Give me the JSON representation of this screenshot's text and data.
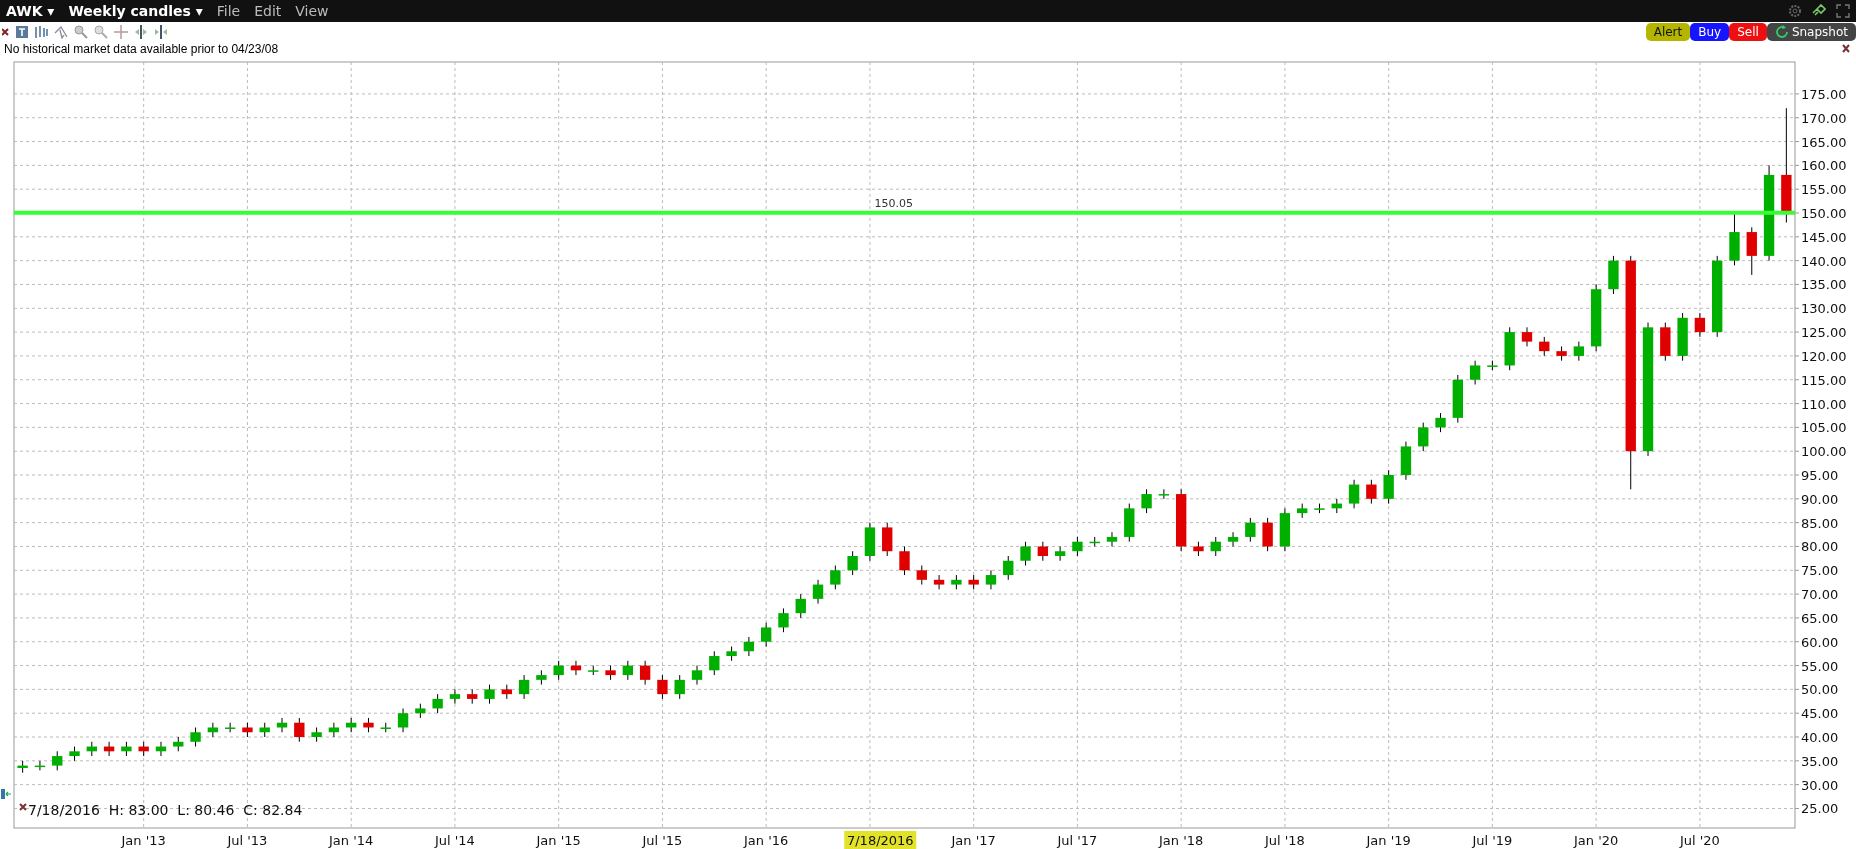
{
  "menubar": {
    "dropdowns": [
      {
        "label": "AWK",
        "caret": "▾"
      },
      {
        "label": "Weekly candles",
        "caret": "▾"
      }
    ],
    "menus": [
      "File",
      "Edit",
      "View"
    ]
  },
  "toolbar": {
    "buttons": [
      {
        "label": "Alert",
        "kind": "alert"
      },
      {
        "label": "Buy",
        "kind": "buy"
      },
      {
        "label": "Sell",
        "kind": "sell"
      },
      {
        "label": "Snapshot",
        "kind": "snapshot"
      }
    ]
  },
  "notice": "No historical market data available prior to 04/23/08",
  "crosshair": {
    "date": "7/18/2016",
    "readout": "H: 83.00  L: 80.46  C: 82.84",
    "axis_label": "7/18/2016"
  },
  "chart_data": {
    "type": "candlestick",
    "grid": true,
    "categories": [
      null,
      null,
      null,
      null,
      null,
      null,
      null,
      "Jan '13",
      null,
      null,
      null,
      null,
      null,
      "Jul '13",
      null,
      null,
      null,
      null,
      null,
      "Jan '14",
      null,
      null,
      null,
      null,
      null,
      "Jul '14",
      null,
      null,
      null,
      null,
      null,
      "Jan '15",
      null,
      null,
      null,
      null,
      null,
      "Jul '15",
      null,
      null,
      null,
      null,
      null,
      "Jan '16",
      null,
      null,
      null,
      null,
      null,
      null,
      null,
      null,
      null,
      null,
      null,
      "Jan '17",
      null,
      null,
      null,
      null,
      null,
      "Jul '17",
      null,
      null,
      null,
      null,
      null,
      "Jan '18",
      null,
      null,
      null,
      null,
      null,
      "Jul '18",
      null,
      null,
      null,
      null,
      null,
      "Jan '19",
      null,
      null,
      null,
      null,
      null,
      "Jul '19",
      null,
      null,
      null,
      null,
      null,
      "Jan '20",
      null,
      null,
      null,
      null,
      null,
      "Jul '20",
      null,
      null,
      null,
      null,
      null
    ],
    "ohlc": [
      [
        33.5,
        35,
        32.5,
        34
      ],
      [
        34,
        35,
        33,
        34
      ],
      [
        34,
        37,
        33,
        36
      ],
      [
        36,
        38,
        35,
        37
      ],
      [
        37,
        39,
        36,
        38
      ],
      [
        38,
        39,
        36,
        37
      ],
      [
        37,
        39,
        36,
        38
      ],
      [
        38,
        39,
        36,
        37
      ],
      [
        37,
        39,
        36,
        38
      ],
      [
        38,
        40,
        37,
        39
      ],
      [
        39,
        42,
        38,
        41
      ],
      [
        41,
        43,
        40,
        42
      ],
      [
        42,
        43,
        41,
        42
      ],
      [
        42,
        43,
        40,
        41
      ],
      [
        41,
        43,
        40,
        42
      ],
      [
        42,
        44,
        41,
        43
      ],
      [
        43,
        44,
        39,
        40
      ],
      [
        40,
        42,
        39,
        41
      ],
      [
        41,
        43,
        40,
        42
      ],
      [
        42,
        44,
        41,
        43
      ],
      [
        43,
        44,
        41,
        42
      ],
      [
        42,
        43,
        41,
        42
      ],
      [
        42,
        46,
        41,
        45
      ],
      [
        45,
        47,
        44,
        46
      ],
      [
        46,
        49,
        45,
        48
      ],
      [
        48,
        50,
        47,
        49
      ],
      [
        49,
        50,
        47,
        48
      ],
      [
        48,
        51,
        47,
        50
      ],
      [
        50,
        51,
        48,
        49
      ],
      [
        49,
        53,
        48,
        52
      ],
      [
        52,
        54,
        51,
        53
      ],
      [
        53,
        56,
        52,
        55
      ],
      [
        55,
        56,
        53,
        54
      ],
      [
        54,
        55,
        53,
        54
      ],
      [
        54,
        55,
        52,
        53
      ],
      [
        53,
        56,
        52,
        55
      ],
      [
        55,
        56,
        51,
        52
      ],
      [
        52,
        53,
        48,
        49
      ],
      [
        49,
        53,
        48,
        52
      ],
      [
        52,
        55,
        51,
        54
      ],
      [
        54,
        58,
        53,
        57
      ],
      [
        57,
        59,
        56,
        58
      ],
      [
        58,
        61,
        57,
        60
      ],
      [
        60,
        64,
        59,
        63
      ],
      [
        63,
        67,
        62,
        66
      ],
      [
        66,
        70,
        65,
        69
      ],
      [
        69,
        73,
        68,
        72
      ],
      [
        72,
        76,
        71,
        75
      ],
      [
        75,
        79,
        74,
        78
      ],
      [
        78,
        85,
        77,
        84
      ],
      [
        84,
        85,
        78,
        79
      ],
      [
        79,
        80,
        74,
        75
      ],
      [
        75,
        76,
        72,
        73
      ],
      [
        73,
        74,
        71,
        72
      ],
      [
        72,
        74,
        71,
        73
      ],
      [
        73,
        74,
        71,
        72
      ],
      [
        72,
        75,
        71,
        74
      ],
      [
        74,
        78,
        73,
        77
      ],
      [
        77,
        81,
        76,
        80
      ],
      [
        80,
        81,
        77,
        78
      ],
      [
        78,
        80,
        77,
        79
      ],
      [
        79,
        82,
        78,
        81
      ],
      [
        81,
        82,
        80,
        81
      ],
      [
        81,
        83,
        80,
        82
      ],
      [
        82,
        89,
        81,
        88
      ],
      [
        88,
        92,
        87,
        91
      ],
      [
        91,
        92,
        90,
        91
      ],
      [
        91,
        92,
        79,
        80
      ],
      [
        80,
        81,
        78,
        79
      ],
      [
        79,
        82,
        78,
        81
      ],
      [
        81,
        83,
        80,
        82
      ],
      [
        82,
        86,
        81,
        85
      ],
      [
        85,
        86,
        79,
        80
      ],
      [
        80,
        88,
        79,
        87
      ],
      [
        87,
        89,
        86,
        88
      ],
      [
        88,
        89,
        87,
        88
      ],
      [
        88,
        90,
        87,
        89
      ],
      [
        89,
        94,
        88,
        93
      ],
      [
        93,
        94,
        89,
        90
      ],
      [
        90,
        96,
        89,
        95
      ],
      [
        95,
        102,
        94,
        101
      ],
      [
        101,
        106,
        100,
        105
      ],
      [
        105,
        108,
        104,
        107
      ],
      [
        107,
        116,
        106,
        115
      ],
      [
        115,
        119,
        114,
        118
      ],
      [
        118,
        119,
        117,
        118
      ],
      [
        118,
        126,
        117,
        125
      ],
      [
        125,
        126,
        122,
        123
      ],
      [
        123,
        124,
        120,
        121
      ],
      [
        121,
        122,
        119,
        120
      ],
      [
        120,
        123,
        119,
        122
      ],
      [
        122,
        135,
        121,
        134
      ],
      [
        134,
        141,
        133,
        140
      ],
      [
        140,
        141,
        92,
        100
      ],
      [
        100,
        127,
        99,
        126
      ],
      [
        126,
        127,
        119,
        120
      ],
      [
        120,
        129,
        119,
        128
      ],
      [
        128,
        129,
        124,
        125
      ],
      [
        125,
        141,
        124,
        140
      ],
      [
        140,
        150,
        139,
        146
      ],
      [
        146,
        147,
        137,
        141
      ],
      [
        141,
        160,
        140,
        158
      ],
      [
        158,
        172,
        148,
        150
      ]
    ],
    "ylim": [
      20.9,
      181.7
    ],
    "yticks": [
      {
        "value": 25,
        "label": "25.00"
      },
      {
        "value": 30,
        "label": "30.00"
      },
      {
        "value": 35,
        "label": "35.00"
      },
      {
        "value": 40,
        "label": "40.00"
      },
      {
        "value": 45,
        "label": "45.00"
      },
      {
        "value": 50,
        "label": "50.00"
      },
      {
        "value": 55,
        "label": "55.00"
      },
      {
        "value": 60,
        "label": "60.00"
      },
      {
        "value": 65,
        "label": "65.00"
      },
      {
        "value": 70,
        "label": "70.00"
      },
      {
        "value": 75,
        "label": "75.00"
      },
      {
        "value": 80,
        "label": "80.00"
      },
      {
        "value": 85,
        "label": "85.00"
      },
      {
        "value": 90,
        "label": "90.00"
      },
      {
        "value": 95,
        "label": "95.00"
      },
      {
        "value": 100,
        "label": "100.00"
      },
      {
        "value": 105,
        "label": "105.00"
      },
      {
        "value": 110,
        "label": "110.00"
      },
      {
        "value": 115,
        "label": "115.00"
      },
      {
        "value": 120,
        "label": "120.00"
      },
      {
        "value": 125,
        "label": "125.00"
      },
      {
        "value": 130,
        "label": "130.00"
      },
      {
        "value": 135,
        "label": "135.00"
      },
      {
        "value": 140,
        "label": "140.00"
      },
      {
        "value": 145,
        "label": "145.00"
      },
      {
        "value": 150,
        "label": "150.00"
      },
      {
        "value": 155,
        "label": "155.00"
      },
      {
        "value": 160,
        "label": "160.00"
      },
      {
        "value": 165,
        "label": "165.00"
      },
      {
        "value": 170,
        "label": "170.00"
      },
      {
        "value": 175,
        "label": "175.00"
      }
    ],
    "ref_lines": [
      {
        "axis": "y",
        "value": 150.05,
        "label": "150.05",
        "color": "#33ff33"
      }
    ]
  }
}
